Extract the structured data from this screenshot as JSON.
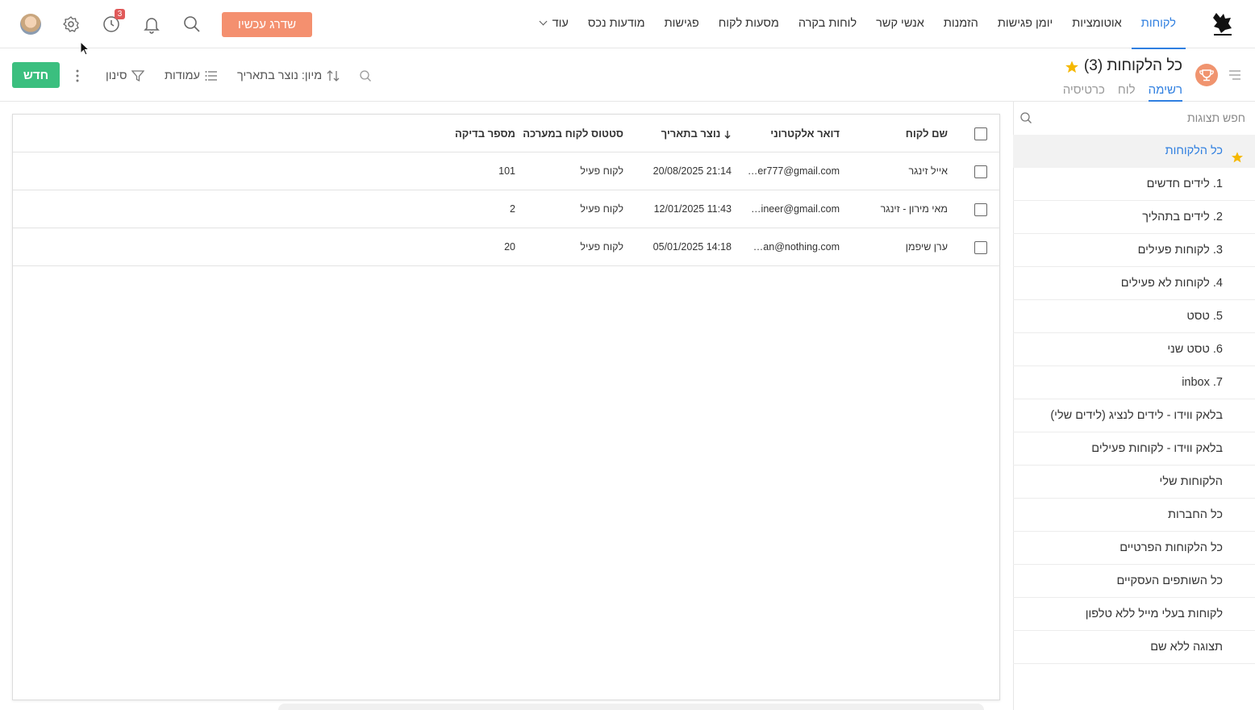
{
  "nav": {
    "items": [
      "לקוחות",
      "אוטומציות",
      "יומן פגישות",
      "הזמנות",
      "אנשי קשר",
      "לוחות בקרה",
      "מסעות לקוח",
      "פגישות",
      "מודעות נכס"
    ],
    "more_label": "עוד",
    "active_index": 0,
    "upgrade_label": "שדרג עכשיו",
    "notification_badge": "3"
  },
  "header": {
    "title": "כל הלקוחות (3)",
    "view_tabs": [
      "רשימה",
      "לוח",
      "כרטיסיה"
    ],
    "active_view": 0
  },
  "toolbar": {
    "new_label": "חדש",
    "filter_label": "סינון",
    "columns_label": "עמודות",
    "sort_label": "מיון: נוצר בתאריך"
  },
  "sidebar": {
    "search_placeholder": "חפש תצוגות",
    "items": [
      "כל הלקוחות",
      "1. לידים חדשים",
      "2. לידים בתהליך",
      "3. לקוחות פעילים",
      "4. לקוחות לא פעילים",
      "5. טסט",
      "6. טסט שני",
      "7. inbox",
      "בלאק ווידו - לידים לנציג (לידים שלי)",
      "בלאק ווידו - לקוחות פעילים",
      "הלקוחות שלי",
      "כל החברות",
      "כל הלקוחות הפרטיים",
      "כל השותפים העסקיים",
      "לקוחות בעלי מייל ללא טלפון",
      "תצוגה ללא שם"
    ],
    "active_index": 0
  },
  "table": {
    "columns": [
      "שם לקוח",
      "דואר אלקטרוני",
      "נוצר בתאריך",
      "סטטוס לקוח במערכה",
      "מספר בדיקה"
    ],
    "rows": [
      {
        "name": "אייל זינגר",
        "email": "…er777@gmail.com",
        "created": "20/08/2025 21:14",
        "status": "לקוח פעיל",
        "number": "101"
      },
      {
        "name": "מאי מירון - זינגר",
        "email": "…ineer@gmail.com",
        "created": "12/01/2025 11:43",
        "status": "לקוח פעיל",
        "number": "2"
      },
      {
        "name": "ערן שיפמן",
        "email": "…an@nothing.com",
        "created": "05/01/2025 14:18",
        "status": "לקוח פעיל",
        "number": "20"
      }
    ]
  },
  "colors": {
    "accent": "#2f7fe0",
    "upgrade": "#f4906f",
    "new_button": "#3bbf7f",
    "star": "#f5b800",
    "badge": "#e05a5a"
  }
}
